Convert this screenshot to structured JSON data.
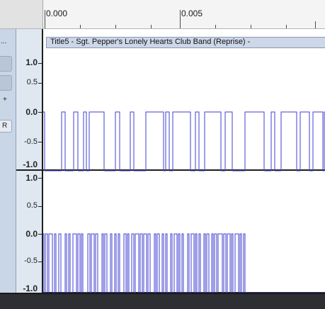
{
  "ruler": {
    "labels": [
      "0.000",
      "0.005"
    ]
  },
  "panel": {
    "menu_dots": "...",
    "gain_symbol": "+",
    "pan_label": "R"
  },
  "track": {
    "title": "Title5 - Sgt. Pepper's Lonely Hearts Club Band (Reprise) -",
    "channels": [
      {
        "scale": [
          "1.0",
          "0.5",
          "0.0",
          "-0.5",
          "-1.0"
        ]
      },
      {
        "scale": [
          "1.0",
          "0.5",
          "0.0",
          "-0.5",
          "-1.0"
        ]
      }
    ]
  },
  "colors": {
    "waveform": "#3f3fd0",
    "panel_bg": "#c9d6e6",
    "ruler_bg": "#f4f4f4"
  }
}
